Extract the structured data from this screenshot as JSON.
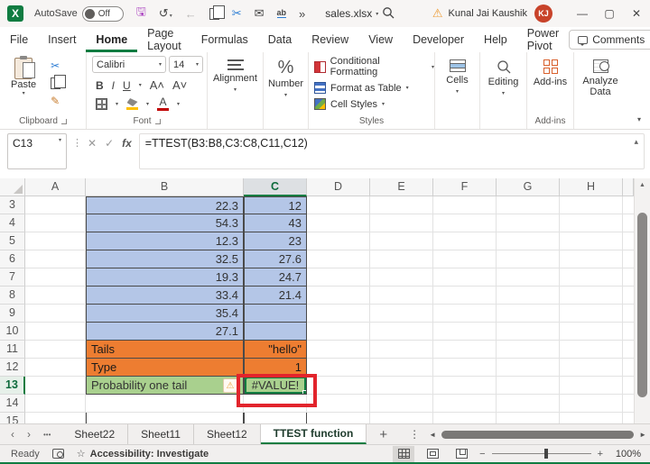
{
  "titlebar": {
    "autosave_label": "AutoSave",
    "autosave_state": "Off",
    "filename": "sales.xlsx",
    "user_name": "Kunal Jai Kaushik",
    "user_initials": "KJ"
  },
  "ribbon_tabs": [
    "File",
    "Insert",
    "Home",
    "Page Layout",
    "Formulas",
    "Data",
    "Review",
    "View",
    "Developer",
    "Help",
    "Power Pivot"
  ],
  "active_tab": "Home",
  "comments_label": "Comments",
  "ribbon": {
    "paste_label": "Paste",
    "clipboard_group": "Clipboard",
    "font_name": "Calibri",
    "font_size": "14",
    "font_group": "Font",
    "bold": "B",
    "italic": "I",
    "underline": "U",
    "alignment_label": "Alignment",
    "number_label": "Number",
    "styles": {
      "conditional": "Conditional Formatting",
      "format_table": "Format as Table",
      "cell_styles": "Cell Styles",
      "group": "Styles"
    },
    "cells_label": "Cells",
    "editing_label": "Editing",
    "addins_label": "Add-ins",
    "analyze_label1": "Analyze",
    "analyze_label2": "Data",
    "addins_group": "Add-ins"
  },
  "formula_bar": {
    "name_box": "C13",
    "formula": "=TTEST(B3:B8,C3:C8,C11,C12)",
    "fx": "fx"
  },
  "grid": {
    "col_headers": [
      "A",
      "B",
      "C",
      "D",
      "E",
      "F",
      "G",
      "H"
    ],
    "selected_cell": "C13",
    "rows": [
      {
        "num": "3",
        "b": "22.3",
        "c": "12"
      },
      {
        "num": "4",
        "b": "54.3",
        "c": "43"
      },
      {
        "num": "5",
        "b": "12.3",
        "c": "23"
      },
      {
        "num": "6",
        "b": "32.5",
        "c": "27.6"
      },
      {
        "num": "7",
        "b": "19.3",
        "c": "24.7"
      },
      {
        "num": "8",
        "b": "33.4",
        "c": "21.4"
      },
      {
        "num": "9",
        "b": "35.4",
        "c": ""
      },
      {
        "num": "10",
        "b": "27.1",
        "c": ""
      },
      {
        "num": "11",
        "b": "Tails",
        "c": "\"hello\""
      },
      {
        "num": "12",
        "b": "Type",
        "c": "1"
      },
      {
        "num": "13",
        "b": "Probability one tail",
        "c": "#VALUE!"
      },
      {
        "num": "14",
        "b": "",
        "c": ""
      },
      {
        "num": "15",
        "b": "",
        "c": ""
      }
    ]
  },
  "sheet_bar": {
    "tabs": [
      "Sheet22",
      "Sheet11",
      "Sheet12",
      "TTEST function"
    ],
    "active": "TTEST function"
  },
  "status_bar": {
    "ready": "Ready",
    "accessibility": "Accessibility: Investigate",
    "zoom": "100%"
  },
  "icons": {
    "undo": "↺",
    "back": "←",
    "cut": "✂",
    "email": "✉",
    "spell": "ab",
    "overflow": "»",
    "chevron_down": "▾",
    "chevron_up": "▴",
    "minimize": "—",
    "maximize": "▢",
    "close": "✕",
    "warning": "⚠",
    "percent": "%",
    "cancel": "✕",
    "enter": "✓",
    "nav_left": "‹",
    "nav_right": "›",
    "ellipsis": "•••",
    "dots": "⋮",
    "plus": "+",
    "minus": "−",
    "scroll_left": "◄",
    "scroll_right": "►",
    "scroll_up": "▲",
    "grow_font": "A˄",
    "shrink_font": "A˅",
    "font_color": "A",
    "searchq": "⌕"
  },
  "colors": {
    "accent_green": "#107C41",
    "cell_blue": "#B4C6E7",
    "cell_orange": "#ED7D31",
    "cell_green": "#A9D08E",
    "annotation_red": "#E2242C",
    "avatar_orange": "#C8432A",
    "error_value": "#VALUE!"
  }
}
